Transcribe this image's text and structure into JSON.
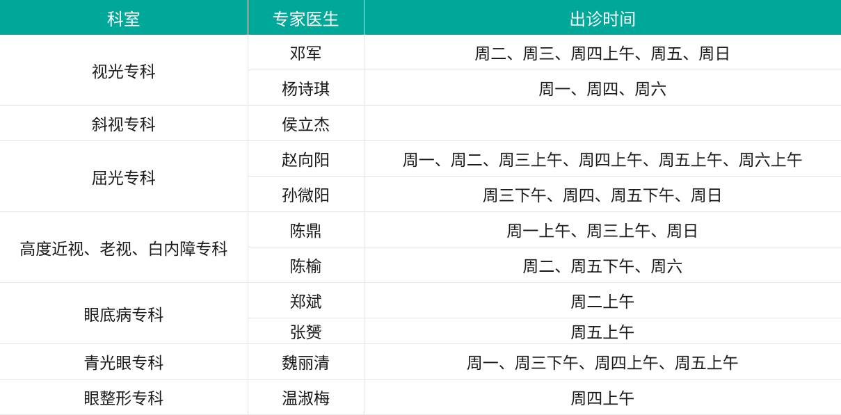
{
  "headers": {
    "department": "科室",
    "doctor": "专家医生",
    "time": "出诊时间"
  },
  "departments": [
    {
      "name": "视光专科"
    },
    {
      "name": "斜视专科"
    },
    {
      "name": "屈光专科"
    },
    {
      "name": "高度近视、老视、白内障专科"
    },
    {
      "name": "眼底病专科"
    },
    {
      "name": "青光眼专科"
    },
    {
      "name": "眼整形专科"
    }
  ],
  "rows": [
    {
      "doctor": "邓军",
      "time": "周二、周三、周四上午、周五、周日"
    },
    {
      "doctor": "杨诗琪",
      "time": "周一、周四、周六"
    },
    {
      "doctor": "侯立杰",
      "time": ""
    },
    {
      "doctor": "赵向阳",
      "time": "周一、周二、周三上午、周四上午、周五上午、周六上午"
    },
    {
      "doctor": "孙微阳",
      "time": "周三下午、周四、周五下午、周日"
    },
    {
      "doctor": "陈鼎",
      "time": "周一上午、周三上午、周日"
    },
    {
      "doctor": "陈榆",
      "time": "周二、周五下午、周六"
    },
    {
      "doctor": "郑斌",
      "time": "周二上午"
    },
    {
      "doctor": "张赟",
      "time": "周五上午"
    },
    {
      "doctor": "魏丽清",
      "time": "周一、周三下午、周四上午、周五上午"
    },
    {
      "doctor": "温淑梅",
      "time": "周四上午"
    }
  ]
}
